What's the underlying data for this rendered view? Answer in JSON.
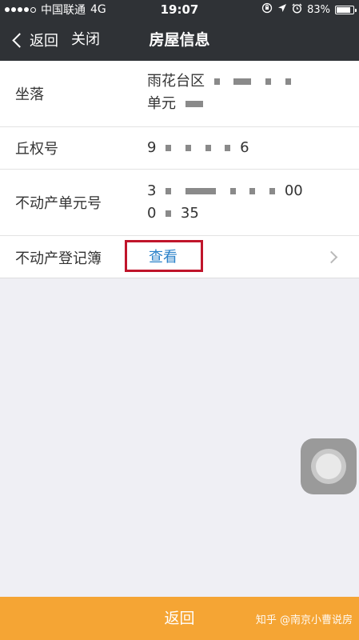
{
  "status_bar": {
    "carrier": "中国联通",
    "network": "4G",
    "time": "19:07",
    "battery_text": "83%",
    "battery_level": 0.83
  },
  "nav": {
    "back_label": "返回",
    "close_label": "关闭",
    "title": "房屋信息"
  },
  "info_rows": [
    {
      "label": "坐落",
      "value_line1": "雨花台区",
      "value_line2": "单元"
    },
    {
      "label": "丘权号",
      "value_start": "9",
      "value_end": "6"
    },
    {
      "label": "不动产单元号",
      "value_line1_start": "3",
      "value_line1_end": "00",
      "value_line2_start": "0",
      "value_line2_end": "35"
    },
    {
      "label": "不动产登记簿",
      "link_label": "查看"
    }
  ],
  "bottom": {
    "back_label": "返回",
    "watermark": "知乎 @南京小曹说房"
  },
  "colors": {
    "nav_background": "#2f3236",
    "link": "#2b82c9",
    "highlight_box": "#c0152b",
    "bottom_bar": "#f5a534",
    "page_background": "#efeff4"
  }
}
